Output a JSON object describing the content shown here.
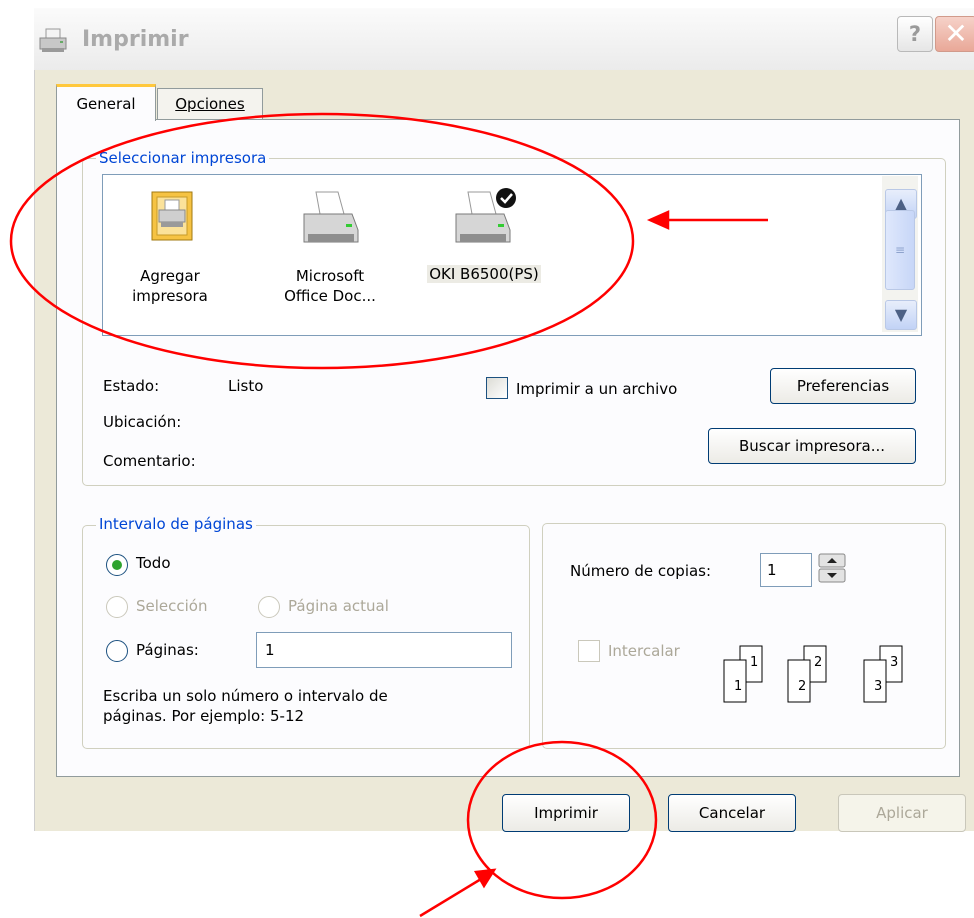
{
  "window": {
    "title": "Imprimir",
    "help": "?",
    "close": "✕"
  },
  "tabs": [
    {
      "label": "General"
    },
    {
      "label": "Opciones"
    }
  ],
  "printer_group": {
    "title": "Seleccionar impresora",
    "printers": [
      {
        "line1": "Agregar",
        "line2": "impresora"
      },
      {
        "line1": "Microsoft",
        "line2": "Office Doc..."
      },
      {
        "line1": "OKI B6500(PS)",
        "line2": ""
      }
    ],
    "scroll_up": "▲",
    "scroll_down": "▼",
    "scroll_grip": "≡",
    "status_label": "Estado:",
    "status_value": "Listo",
    "location_label": "Ubicación:",
    "comment_label": "Comentario:",
    "print_to_file": "Imprimir a un archivo",
    "preferences_button": "Preferencias",
    "find_printer_button": "Buscar impresora..."
  },
  "range_group": {
    "title": "Intervalo de páginas",
    "all": "Todo",
    "selection": "Selección",
    "current_page": "Página actual",
    "pages": "Páginas:",
    "pages_value": "1",
    "hint_line1": "Escriba un solo número o intervalo de",
    "hint_line2": "páginas. Por ejemplo: 5-12"
  },
  "copies_group": {
    "copies_label": "Número de copias:",
    "copies_value": "1",
    "collate": "Intercalar",
    "collate_sheets": [
      "1",
      "1",
      "2",
      "2",
      "3",
      "3"
    ]
  },
  "footer": {
    "print_button": "Imprimir",
    "cancel_button": "Cancelar",
    "apply_button": "Aplicar"
  },
  "colors": {
    "annotation": "#ff0000",
    "group_title": "#0046d5",
    "tab_highlight": "#ffc83c"
  }
}
